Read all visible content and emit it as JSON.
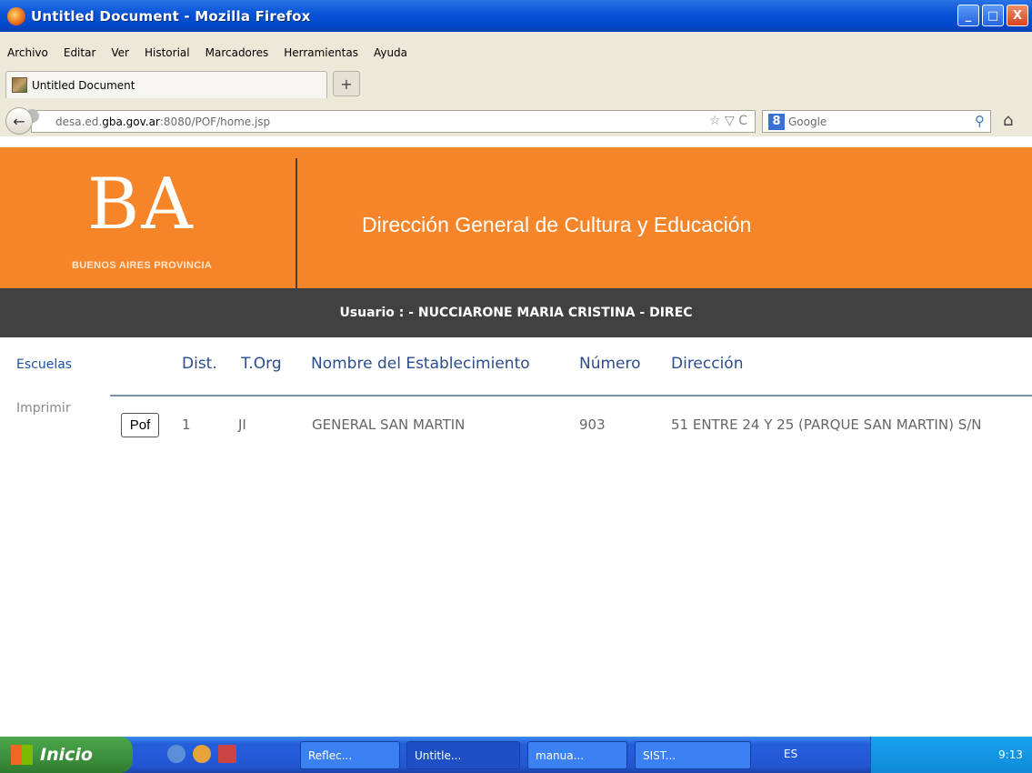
{
  "window": {
    "title": "Untitled Document - Mozilla Firefox",
    "controls": {
      "minimize": "_",
      "maximize": "□",
      "close": "X"
    }
  },
  "menu": [
    "Archivo",
    "Editar",
    "Ver",
    "Historial",
    "Marcadores",
    "Herramientas",
    "Ayuda"
  ],
  "tab": {
    "title": "Untitled Document",
    "new_tab": "+"
  },
  "nav": {
    "back": "←",
    "url_prefix": "desa.ed.",
    "url_host": "gba.gov.ar",
    "url_suffix": ":8080/POF/home.jsp",
    "url_icons": "☆ ▽ C",
    "search_engine": "Google",
    "search_magnifier": "⚲",
    "home": "⌂"
  },
  "header": {
    "logo": "BA",
    "logo_sub": "BUENOS AIRES PROVINCIA",
    "title": "Dirección General de Cultura y Educación"
  },
  "user_bar": "Usuario : - NUCCIARONE MARIA CRISTINA - DIREC",
  "sidebar": {
    "escuelas": "Escuelas",
    "imprimir": "Imprimir"
  },
  "table": {
    "columns": [
      "Dist.",
      "T.Org",
      "Nombre del Establecimiento",
      "Número",
      "Dirección"
    ],
    "rows": [
      {
        "action": "Pof",
        "dist": "1",
        "torg": "JI",
        "nombre": "GENERAL SAN MARTIN",
        "numero": "903",
        "direccion": "51 ENTRE 24 Y 25 (PARQUE SAN MARTIN) S/N"
      }
    ]
  },
  "taskbar": {
    "start": "Inicio",
    "tasks": [
      "Reflec...",
      "Untitle...",
      "manua...",
      "SIST..."
    ],
    "lang": "ES",
    "clock": "9:13"
  }
}
